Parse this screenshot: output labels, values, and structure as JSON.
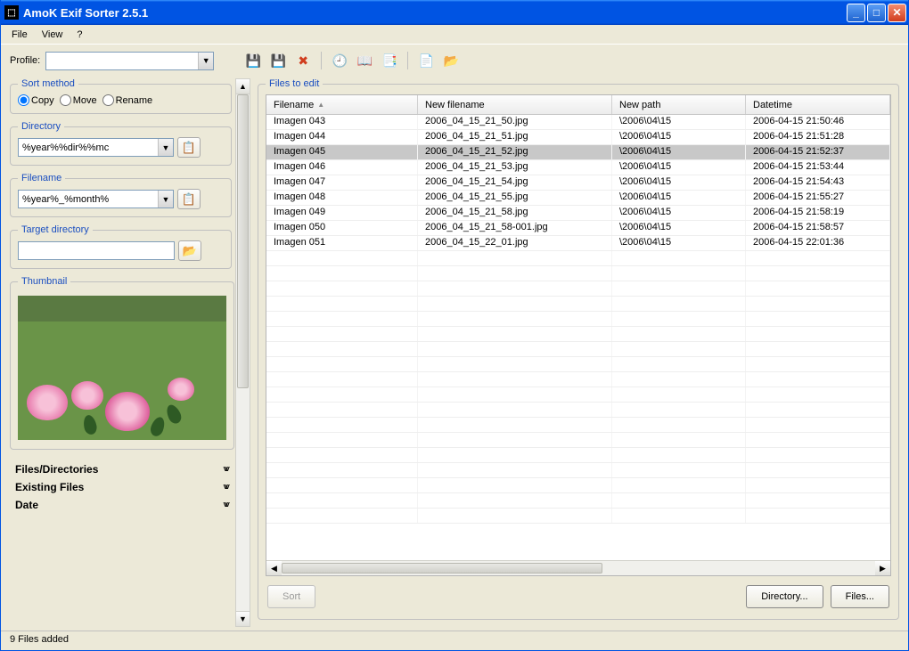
{
  "title": "AmoK Exif Sorter 2.5.1",
  "menu": {
    "file": "File",
    "view": "View",
    "help": "?"
  },
  "profile_label": "Profile:",
  "profile_value": "",
  "toolbar_icons": [
    "save",
    "save-all",
    "delete",
    "history",
    "book",
    "apply",
    "new",
    "open"
  ],
  "left": {
    "sort_method": {
      "legend": "Sort method",
      "copy": "Copy",
      "move": "Move",
      "rename": "Rename",
      "selected": "copy"
    },
    "directory": {
      "legend": "Directory",
      "value": "%year%%dir%%mc"
    },
    "filename": {
      "legend": "Filename",
      "value": "%year%_%month%"
    },
    "target": {
      "legend": "Target directory",
      "value": ""
    },
    "thumbnail": {
      "legend": "Thumbnail"
    },
    "acc": {
      "files_dirs": "Files/Directories",
      "existing": "Existing Files",
      "date": "Date"
    }
  },
  "files": {
    "legend": "Files to edit",
    "columns": {
      "filename": "Filename",
      "new_filename": "New filename",
      "new_path": "New path",
      "datetime": "Datetime"
    },
    "rows": [
      {
        "fn": "Imagen 043",
        "nf": "2006_04_15_21_50.jpg",
        "np": "\\2006\\04\\15",
        "dt": "2006-04-15 21:50:46",
        "sel": false
      },
      {
        "fn": "Imagen 044",
        "nf": "2006_04_15_21_51.jpg",
        "np": "\\2006\\04\\15",
        "dt": "2006-04-15 21:51:28",
        "sel": false
      },
      {
        "fn": "Imagen 045",
        "nf": "2006_04_15_21_52.jpg",
        "np": "\\2006\\04\\15",
        "dt": "2006-04-15 21:52:37",
        "sel": true
      },
      {
        "fn": "Imagen 046",
        "nf": "2006_04_15_21_53.jpg",
        "np": "\\2006\\04\\15",
        "dt": "2006-04-15 21:53:44",
        "sel": false
      },
      {
        "fn": "Imagen 047",
        "nf": "2006_04_15_21_54.jpg",
        "np": "\\2006\\04\\15",
        "dt": "2006-04-15 21:54:43",
        "sel": false
      },
      {
        "fn": "Imagen 048",
        "nf": "2006_04_15_21_55.jpg",
        "np": "\\2006\\04\\15",
        "dt": "2006-04-15 21:55:27",
        "sel": false
      },
      {
        "fn": "Imagen 049",
        "nf": "2006_04_15_21_58.jpg",
        "np": "\\2006\\04\\15",
        "dt": "2006-04-15 21:58:19",
        "sel": false
      },
      {
        "fn": "Imagen 050",
        "nf": "2006_04_15_21_58-001.jpg",
        "np": "\\2006\\04\\15",
        "dt": "2006-04-15 21:58:57",
        "sel": false
      },
      {
        "fn": "Imagen 051",
        "nf": "2006_04_15_22_01.jpg",
        "np": "\\2006\\04\\15",
        "dt": "2006-04-15 22:01:36",
        "sel": false
      }
    ]
  },
  "buttons": {
    "sort": "Sort",
    "directory": "Directory...",
    "files": "Files..."
  },
  "status": "9 Files added"
}
